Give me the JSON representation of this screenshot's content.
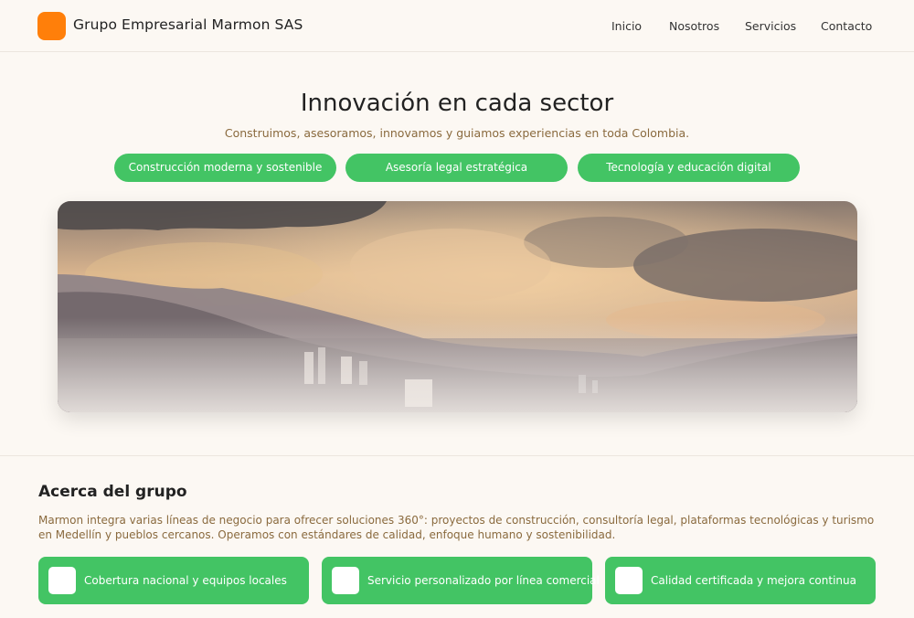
{
  "header": {
    "brand": "Grupo Empresarial Marmon SAS",
    "logo_icon": "logo-square-icon",
    "nav": [
      "Inicio",
      "Nosotros",
      "Servicios",
      "Contacto"
    ]
  },
  "hero": {
    "title": "Innovación en cada sector",
    "subtitle": "Construimos, asesoramos, innovamos y guiamos experiencias en toda Colombia.",
    "pills": [
      "Construcción moderna y sostenible",
      "Asesoría legal estratégica",
      "Tecnología y educación digital"
    ],
    "banner_image": "panoramic-city-mountains-clouds-image"
  },
  "about": {
    "title": "Acerca del grupo",
    "text": "Marmon integra varias líneas de negocio para ofrecer soluciones 360°: proyectos de construcción, consultoría legal, plataformas tecnológicas y turismo en Medellín y pueblos cercanos. Operamos con estándares de calidad, enfoque humano y sostenibilidad.",
    "features": [
      "Cobertura nacional y equipos locales",
      "Servicio personalizado por línea comercial",
      "Calidad certificada y mejora continua"
    ]
  },
  "colors": {
    "accent_orange": "#ff7f0a",
    "accent_green": "#43c464",
    "background": "#fcf8f3",
    "subtitle_brown": "#8a6a3e"
  }
}
